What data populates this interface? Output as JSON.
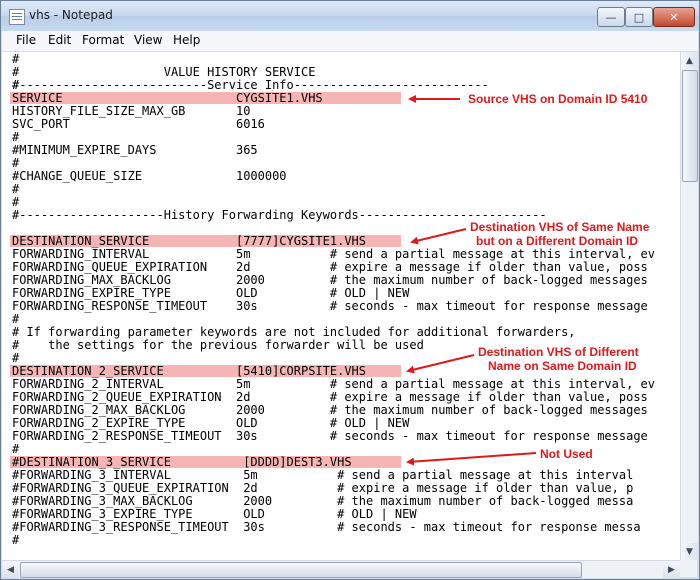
{
  "window": {
    "title": "vhs - Notepad"
  },
  "title_buttons": {
    "minimize": "—",
    "maximize": "□",
    "close": "✕"
  },
  "menu": [
    "File",
    "Edit",
    "Format",
    "View",
    "Help"
  ],
  "icons": {
    "scroll_up": "▲",
    "scroll_down": "▼",
    "scroll_left": "◀",
    "scroll_right": "▶"
  },
  "highlight_color": "#f5b5b5",
  "annotation_color": "#e0191c",
  "lines": [
    "#",
    "#                    VALUE HISTORY SERVICE",
    "#",
    "#--------------------------Service Info---------------------------",
    "SERVICE                        CYGSITE1.VHS",
    "HISTORY_FILE_SIZE_MAX_GB       10",
    "SVC_PORT                       6016",
    "#",
    "#MINIMUM_EXPIRE_DAYS           365",
    "#",
    "#CHANGE_QUEUE_SIZE             1000000",
    "#",
    "#",
    "#--------------------History Forwarding Keywords--------------------------",
    "DESTINATION_SERVICE            [7777]CYGSITE1.VHS",
    "FORWARDING_INTERVAL            5m           # send a partial message at this interval, ev",
    "FORWARDING_QUEUE_EXPIRATION    2d           # expire a message if older than value, poss",
    "FORWARDING_MAX_BACKLOG         2000         # the maximum number of back-logged messages",
    "FORWARDING_EXPIRE_TYPE         OLD          # OLD | NEW",
    "FORWARDING_RESPONSE_TIMEOUT    30s          # seconds - max timeout for response message",
    "#",
    "# If forwarding parameter keywords are not included for additional forwarders,",
    "#    the settings for the previous forwarder will be used",
    "#",
    "DESTINATION_2_SERVICE          [5410]CORPSITE.VHS",
    "FORWARDING_2_INTERVAL          5m           # send a partial message at this interval, ev",
    "FORWARDING_2_QUEUE_EXPIRATION  2d           # expire a message if older than value, poss",
    "FORWARDING_2_MAX_BACKLOG       2000         # the maximum number of back-logged messages",
    "FORWARDING_2_EXPIRE_TYPE       OLD          # OLD | NEW",
    "FORWARDING_2_RESPONSE_TIMEOUT  30s          # seconds - max timeout for response message",
    "#",
    "#DESTINATION_3_SERVICE          [DDDD]DEST3.VHS",
    "#FORWARDING_3_INTERVAL          5m           # send a partial message at this interval",
    "#FORWARDING_3_QUEUE_EXPIRATION  2d           # expire a message if older than value, p",
    "#FORWARDING_3_MAX_BACKLOG       2000         # the maximum number of back-logged messa",
    "#FORWARDING_3_EXPIRE_TYPE       OLD          # OLD | NEW",
    "#FORWARDING_3_RESPONSE_TIMEOUT  30s          # seconds - max timeout for response messa",
    "#"
  ],
  "annotations": [
    "Source VHS on Domain ID 5410",
    "Destination VHS of Same Name",
    "but on a Different Domain ID",
    "Destination VHS of Different",
    "Name on Same Domain ID",
    "Not Used"
  ]
}
